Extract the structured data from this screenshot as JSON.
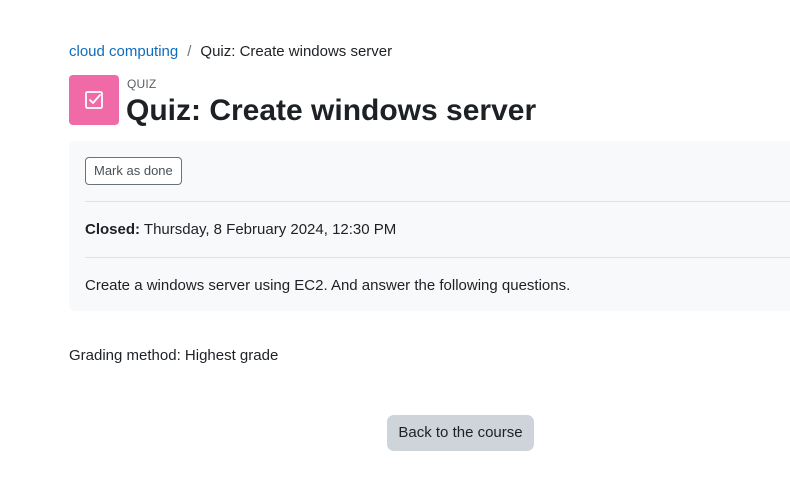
{
  "breadcrumb": {
    "course_link": "cloud computing",
    "separator": "/",
    "current": "Quiz: Create windows server"
  },
  "header": {
    "activity_type": "QUIZ",
    "title": "Quiz: Create windows server",
    "icon": "quiz-checkbox-icon",
    "icon_color": "#ef6aa6"
  },
  "activity_info": {
    "mark_done_label": "Mark as done",
    "closed_label": "Closed:",
    "closed_value": "Thursday, 8 February 2024, 12:30 PM",
    "description": "Create a windows server using EC2. And answer the following questions."
  },
  "grading_method": "Grading method: Highest grade",
  "back_button_label": "Back to the course",
  "colors": {
    "link": "#0f6cbf",
    "info_background": "#f8f9fa",
    "back_button_background": "#ced4da"
  }
}
